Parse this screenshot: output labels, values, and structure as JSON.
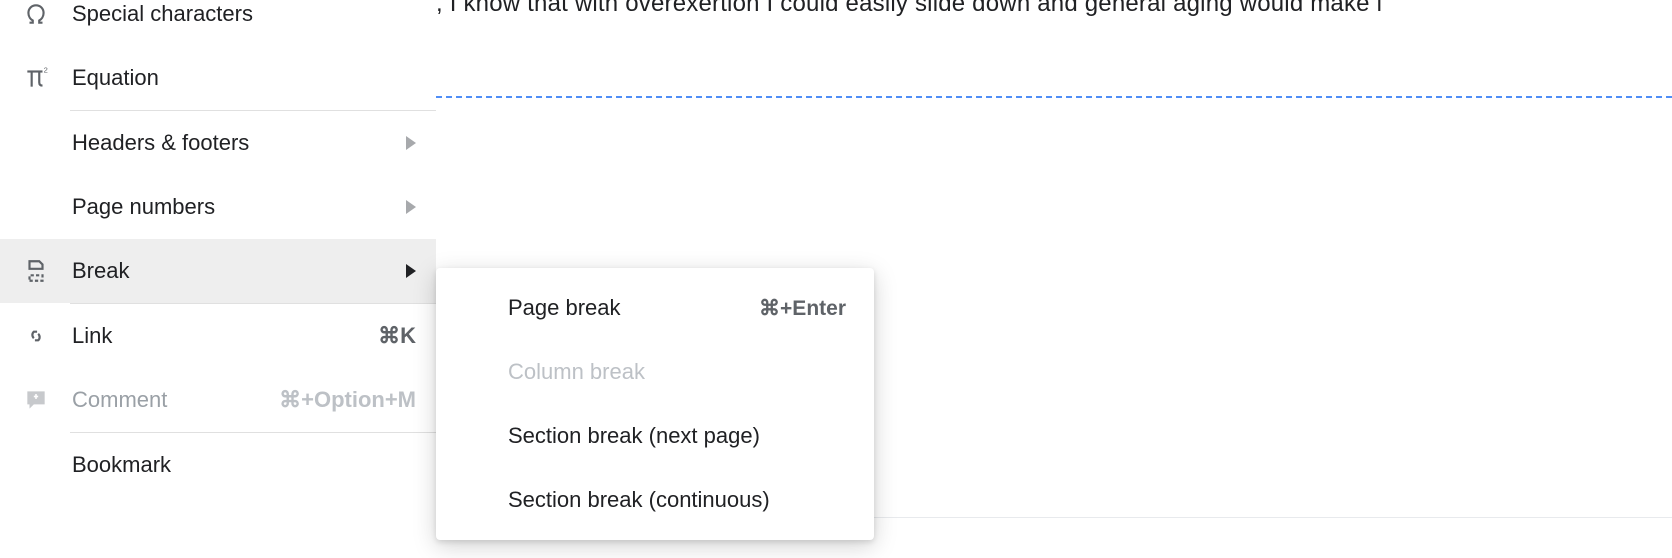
{
  "document": {
    "visible_text": ", I know that with overexertion I could easily slide down and general aging would make i"
  },
  "menu": {
    "special_characters": {
      "label": "Special characters"
    },
    "equation": {
      "label": "Equation"
    },
    "headers_footers": {
      "label": "Headers & footers"
    },
    "page_numbers": {
      "label": "Page numbers"
    },
    "break": {
      "label": "Break"
    },
    "link": {
      "label": "Link",
      "shortcut": "⌘K"
    },
    "comment": {
      "label": "Comment",
      "shortcut": "⌘+Option+M"
    },
    "bookmark": {
      "label": "Bookmark"
    }
  },
  "submenu": {
    "page_break": {
      "label": "Page break",
      "shortcut": "⌘+Enter"
    },
    "column_break": {
      "label": "Column break"
    },
    "section_break_next": {
      "label": "Section break (next page)"
    },
    "section_break_cont": {
      "label": "Section break (continuous)"
    }
  }
}
